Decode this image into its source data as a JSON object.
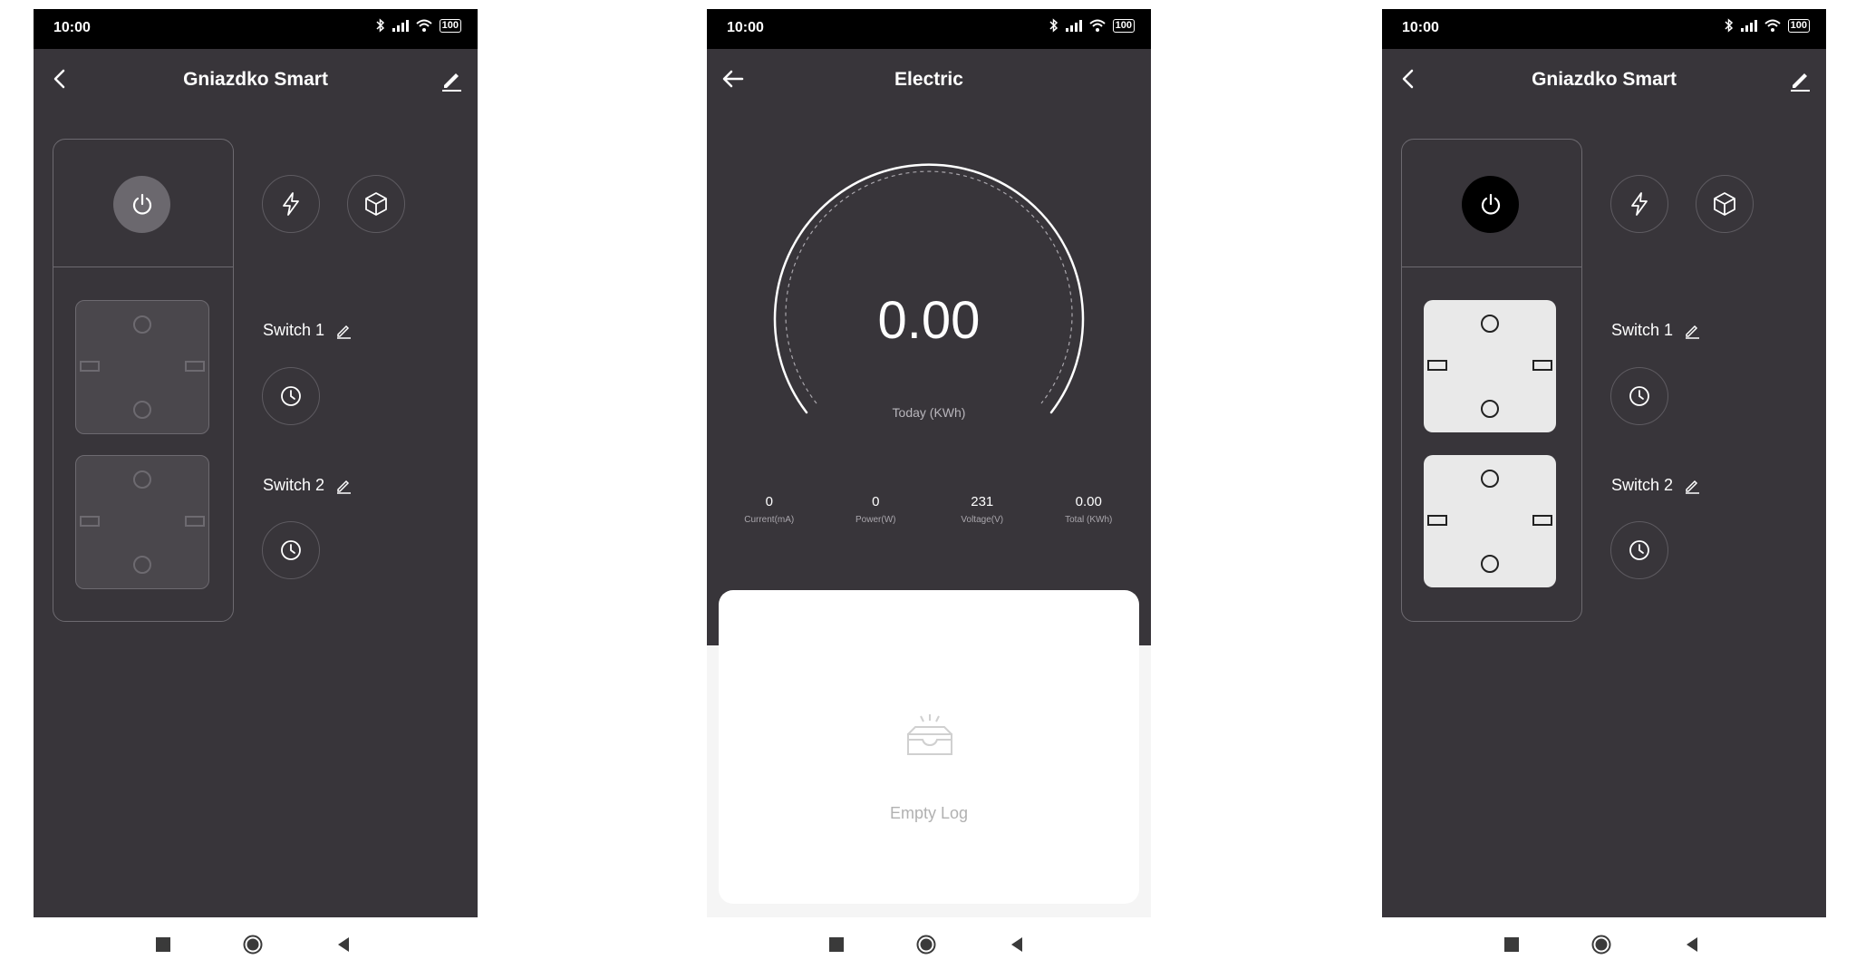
{
  "status": {
    "time": "10:00",
    "battery": "100"
  },
  "device_screen_off": {
    "title": "Gniazdko Smart",
    "switch1_label": "Switch 1",
    "switch2_label": "Switch 2"
  },
  "electric_screen": {
    "title": "Electric",
    "gauge_value": "0.00",
    "gauge_unit": "Today (KWh)",
    "stats": [
      {
        "value": "0",
        "label": "Current(mA)"
      },
      {
        "value": "0",
        "label": "Power(W)"
      },
      {
        "value": "231",
        "label": "Voltage(V)"
      },
      {
        "value": "0.00",
        "label": "Total (KWh)"
      }
    ],
    "empty_text": "Empty Log"
  },
  "device_screen_on": {
    "title": "Gniazdko Smart",
    "switch1_label": "Switch 1",
    "switch2_label": "Switch 2"
  },
  "colors": {
    "screen_bg": "#38353a",
    "power_off_bg": "#6b686e",
    "power_on_bg": "#000000",
    "socket_off_bg": "#4a474c",
    "socket_on_bg": "#e9e9e9"
  }
}
